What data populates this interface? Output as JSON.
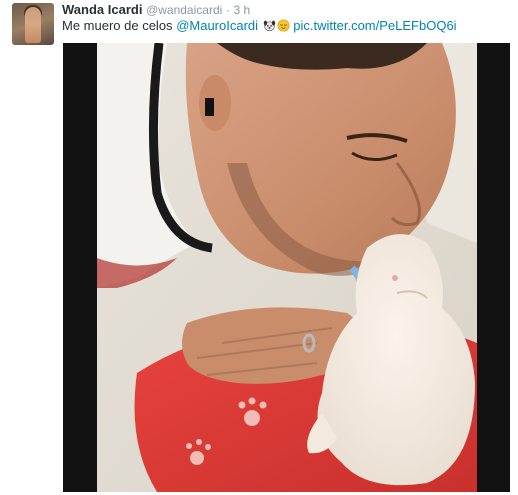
{
  "tweet": {
    "author_name": "Wanda Icardi",
    "author_handle": "@wandaicardi",
    "separator": "·",
    "time": "3 h",
    "text": "Me muero de celos",
    "mention": "@MauroIcardi",
    "emoji_names": [
      "dog-face-icon",
      "relieved-face-icon"
    ],
    "media_link": "pic.twitter.com/PeLEFbOQ6i"
  },
  "colors": {
    "link": "#0084b4",
    "meta": "#8899a6",
    "text": "#292f33",
    "media_background": "#121212"
  }
}
